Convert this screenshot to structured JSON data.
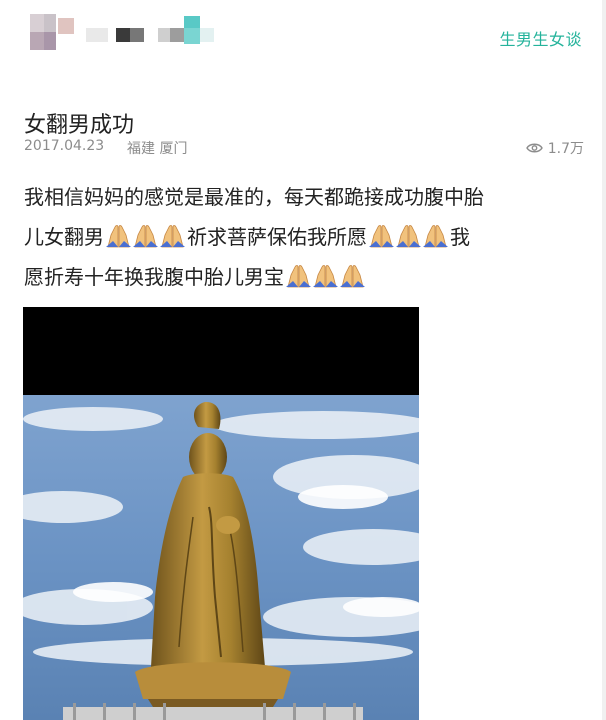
{
  "header": {
    "author_name_blurred": "",
    "category_link": "生男生女谈"
  },
  "post": {
    "title": "女翻男成功",
    "date": "2017.04.23",
    "location": "福建 厦门",
    "views": "1.7万",
    "body_lines": [
      {
        "before": "我相信妈妈的感觉是最准的，每天都跪接成功腹中胎",
        "pray_count": 0,
        "after": ""
      },
      {
        "before": "儿女翻男",
        "pray_count": 3,
        "after": "祈求菩萨保佑我所愿",
        "pray_count_2": 3,
        "after_2": "我"
      },
      {
        "before": "愿折寿十年换我腹中胎儿男宝",
        "pray_count": 3,
        "after": ""
      }
    ],
    "emoji": "folded-hands"
  },
  "icons": {
    "views": "eye-icon",
    "emoji": "folded-hands-icon"
  },
  "colors": {
    "accent": "#24b39b",
    "meta": "#8c8c8c",
    "text": "#222222",
    "photo_top_band": "#000000",
    "sky": "#5d86b8",
    "statue": "#a5812f"
  }
}
